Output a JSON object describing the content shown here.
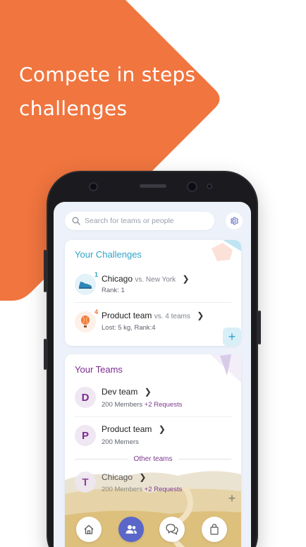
{
  "promo": {
    "headline": "Compete in steps challenges",
    "background_color": "#f0753f"
  },
  "search": {
    "placeholder": "Search for teams or people",
    "icon": "search-icon"
  },
  "settings": {
    "icon": "gear-icon"
  },
  "challenges": {
    "title": "Your Challenges",
    "items": [
      {
        "name": "Chicago",
        "versus": "vs. New York",
        "subtitle": "Rank: 1",
        "badge": "1",
        "icon": "sneaker-icon"
      },
      {
        "name": "Product team",
        "versus": "vs. 4 teams",
        "subtitle": "Lost: 5 kg, Rank:4",
        "badge": "4",
        "icon": "hot-air-balloon-icon"
      }
    ],
    "add_label": "+"
  },
  "teams": {
    "title": "Your Teams",
    "items": [
      {
        "initial": "D",
        "name": "Dev team",
        "members": "200 Members",
        "requests": "+2 Requests"
      },
      {
        "initial": "P",
        "name": "Product team",
        "members": "200 Memers",
        "requests": ""
      }
    ],
    "separator": "Other teams",
    "other_items": [
      {
        "initial": "T",
        "name": "Chicago",
        "members": "200 Members",
        "requests": "+2 Requests"
      }
    ],
    "add_label": "+"
  },
  "nav": {
    "items": [
      {
        "name": "home",
        "icon": "home-icon",
        "active": false
      },
      {
        "name": "teams",
        "icon": "people-icon",
        "active": true
      },
      {
        "name": "chat",
        "icon": "chat-icon",
        "active": false
      },
      {
        "name": "shop",
        "icon": "shopping-bag-icon",
        "active": false
      }
    ]
  },
  "colors": {
    "accent_blue": "#2fa4c8",
    "accent_purple": "#7a2b8f",
    "nav_active": "#5a67c8"
  }
}
